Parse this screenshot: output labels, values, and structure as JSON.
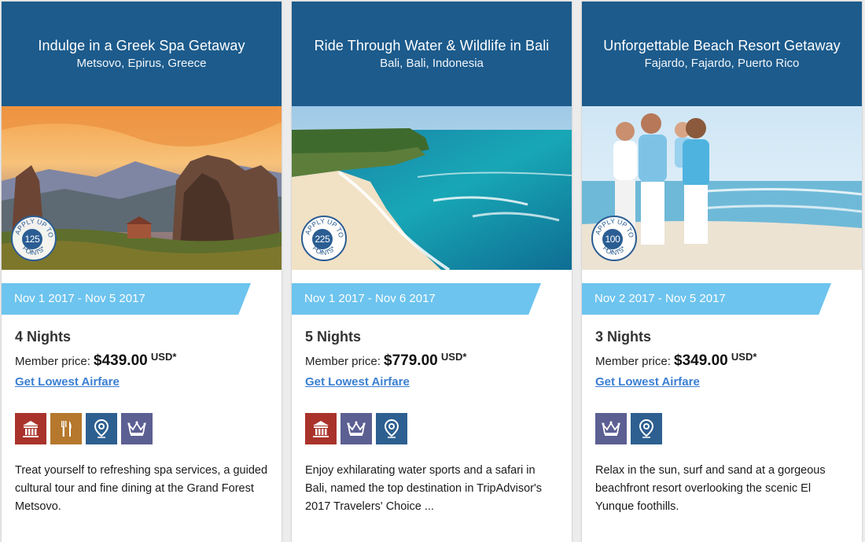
{
  "cards": [
    {
      "title": "Indulge in a Greek Spa Getaway",
      "location": "Metsovo, Epirus, Greece",
      "points_label": "APPLY UP TO POINTS*",
      "points": "125",
      "dates": "Nov 1 2017 - Nov 5 2017",
      "nights": "4 Nights",
      "price_label": "Member price:",
      "price": "$439.00",
      "currency": "USD*",
      "airfare_link": "Get Lowest Airfare",
      "amenities": [
        "culture",
        "dining",
        "location",
        "luxury"
      ],
      "description": "Treat yourself to refreshing spa services, a guided cultural tour and fine dining at the Grand Forest Metsovo."
    },
    {
      "title": "Ride Through Water & Wildlife in Bali",
      "location": "Bali, Bali, Indonesia",
      "points_label": "APPLY UP TO POINTS*",
      "points": "225",
      "dates": "Nov 1 2017 - Nov 6 2017",
      "nights": "5 Nights",
      "price_label": "Member price:",
      "price": "$779.00",
      "currency": "USD*",
      "airfare_link": "Get Lowest Airfare",
      "amenities": [
        "culture",
        "luxury",
        "location"
      ],
      "description": "Enjoy exhilarating water sports and a safari in Bali, named the top destination in TripAdvisor's 2017 Travelers' Choice ..."
    },
    {
      "title": "Unforgettable Beach Resort Getaway",
      "location": "Fajardo, Fajardo, Puerto Rico",
      "points_label": "APPLY UP TO POINTS*",
      "points": "100",
      "dates": "Nov 2 2017 - Nov 5 2017",
      "nights": "3 Nights",
      "price_label": "Member price:",
      "price": "$349.00",
      "currency": "USD*",
      "airfare_link": "Get Lowest Airfare",
      "amenities": [
        "luxury",
        "location"
      ],
      "description": "Relax in the sun, surf and sand at a gorgeous beachfront resort overlooking the scenic El Yunque foothills."
    }
  ],
  "icons": {
    "culture": "museum-icon",
    "dining": "fork-knife-icon",
    "location": "map-pin-icon",
    "luxury": "crown-icon"
  },
  "colors": {
    "header": "#1c5b8c",
    "date_band": "#6dc4ee",
    "link": "#3b7fd2",
    "culture": "#a9322a",
    "dining": "#b5782d",
    "location": "#2d5f90",
    "luxury": "#5c5f92"
  }
}
